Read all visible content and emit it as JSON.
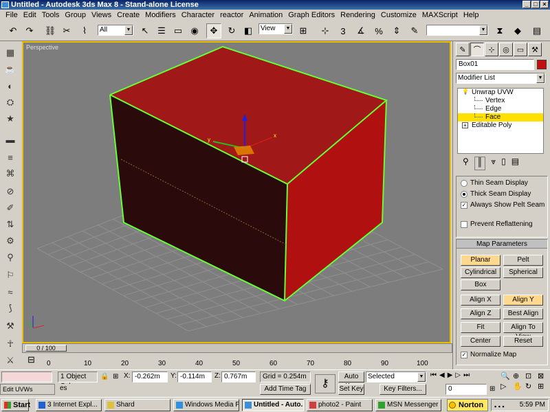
{
  "title_bar": {
    "title": "Untitled - Autodesk 3ds Max 8 - Stand-alone License"
  },
  "menu": [
    "File",
    "Edit",
    "Tools",
    "Group",
    "Views",
    "Create",
    "Modifiers",
    "Character",
    "reactor",
    "Animation",
    "Graph Editors",
    "Rendering",
    "Customize",
    "MAXScript",
    "Help"
  ],
  "toolbar": {
    "selection_filter": "All",
    "ref_coord": "View"
  },
  "viewport": {
    "label": "Perspective",
    "box_front_color": "#2a0a0a",
    "box_top_color": "#a01818",
    "box_side_color": "#b01010",
    "selection_color": "#66ff33",
    "grid_color": "#909090",
    "background_color": "#7d7d7d",
    "gizmo_x": "x",
    "gizmo_y": "y"
  },
  "command_panel": {
    "object_name": "Box01",
    "object_color": "#c01010",
    "modifier_list": "Modifier List",
    "stack": [
      {
        "label": "Unwrap UVW",
        "level": 0,
        "icon": "bulb-icon",
        "selected": false
      },
      {
        "label": "Vertex",
        "level": 1,
        "selected": false
      },
      {
        "label": "Edge",
        "level": 1,
        "selected": false
      },
      {
        "label": "Face",
        "level": 1,
        "selected": true
      },
      {
        "label": "Editable Poly",
        "level": 0,
        "icon": "plus-icon",
        "selected": false
      }
    ],
    "seam": {
      "thin": "Thin Seam Display",
      "thick": "Thick Seam Display",
      "always_show": "Always Show Pelt Seam",
      "prevent": "Prevent Reflattening"
    },
    "map_params": {
      "header": "Map Parameters",
      "planar": "Planar",
      "pelt": "Pelt",
      "cylindrical": "Cylindrical",
      "spherical": "Spherical",
      "box": "Box",
      "align_x": "Align X",
      "align_y": "Align Y",
      "align_z": "Align Z",
      "best_align": "Best Align",
      "fit": "Fit",
      "align_to_view": "Align To View",
      "center": "Center",
      "reset": "Reset",
      "normalize_map": "Normalize Map"
    }
  },
  "timeline": {
    "frame_label": "0 / 100",
    "ticks": [
      "0",
      "10",
      "20",
      "30",
      "40",
      "50",
      "60",
      "70",
      "80",
      "90",
      "100"
    ]
  },
  "status": {
    "script_field": "",
    "selection": "1 Object Sele",
    "hint": "es",
    "x_label": "X:",
    "x_value": "-0.262m",
    "y_label": "Y:",
    "y_value": "-0.114m",
    "z_label": "Z:",
    "z_value": "0.767m",
    "grid": "Grid = 0.254m",
    "add_time_tag": "Add Time Tag",
    "auto_key": "Auto Key",
    "set_key": "Set Key",
    "key_mode": "Selected",
    "key_filters": "Key Filters...",
    "frame": "0",
    "edit_uvws": "Edit UVWs"
  },
  "taskbar": {
    "start": "Start",
    "tasks": [
      {
        "label": "3 Internet Expl...",
        "active": false
      },
      {
        "label": "Shard",
        "active": false
      },
      {
        "label": "Windows Media P...",
        "active": false
      },
      {
        "label": "Untitled - Auto...",
        "active": true
      },
      {
        "label": "photo2 - Paint",
        "active": false
      },
      {
        "label": "MSN Messenger",
        "active": false
      }
    ],
    "norton": "Norton",
    "clock": "5:59 PM"
  }
}
